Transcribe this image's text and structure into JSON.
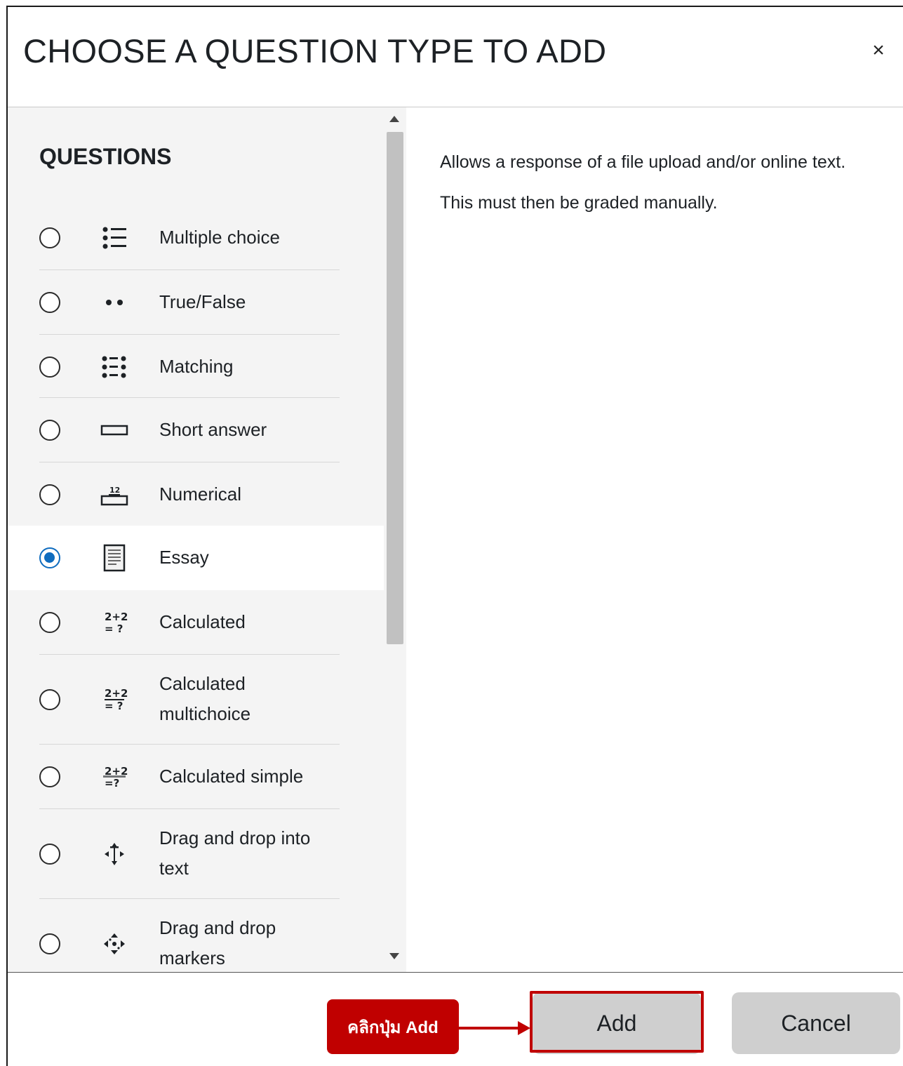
{
  "dialog": {
    "title": "CHOOSE A QUESTION TYPE TO ADD",
    "close_symbol": "×"
  },
  "questions": {
    "heading": "QUESTIONS",
    "selected": "Essay",
    "items": [
      {
        "label": "Multiple choice",
        "icon": "multiple-choice-icon",
        "checked": false
      },
      {
        "label": "True/False",
        "icon": "true-false-icon",
        "checked": false
      },
      {
        "label": "Matching",
        "icon": "matching-icon",
        "checked": false
      },
      {
        "label": "Short answer",
        "icon": "short-answer-icon",
        "checked": false
      },
      {
        "label": "Numerical",
        "icon": "numerical-icon",
        "checked": false
      },
      {
        "label": "Essay",
        "icon": "essay-icon",
        "checked": true
      },
      {
        "label": "Calculated",
        "icon": "calculated-icon",
        "checked": false
      },
      {
        "label": "Calculated multichoice",
        "icon": "calculated-multichoice-icon",
        "checked": false
      },
      {
        "label": "Calculated simple",
        "icon": "calculated-simple-icon",
        "checked": false
      },
      {
        "label": "Drag and drop into text",
        "icon": "drag-drop-text-icon",
        "checked": false
      },
      {
        "label": "Drag and drop markers",
        "icon": "drag-drop-markers-icon",
        "checked": false
      }
    ]
  },
  "description": {
    "line1": "Allows a response of a file upload and/or online text.",
    "line2": "This must then be graded manually."
  },
  "footer": {
    "add_label": "Add",
    "cancel_label": "Cancel"
  },
  "annotation": {
    "callout_text": "คลิกปุ่ม Add",
    "color": "#c00000"
  },
  "colors": {
    "accent": "#0f6cbf",
    "list_background": "#f4f4f4",
    "button_background": "#cfcfcf"
  }
}
